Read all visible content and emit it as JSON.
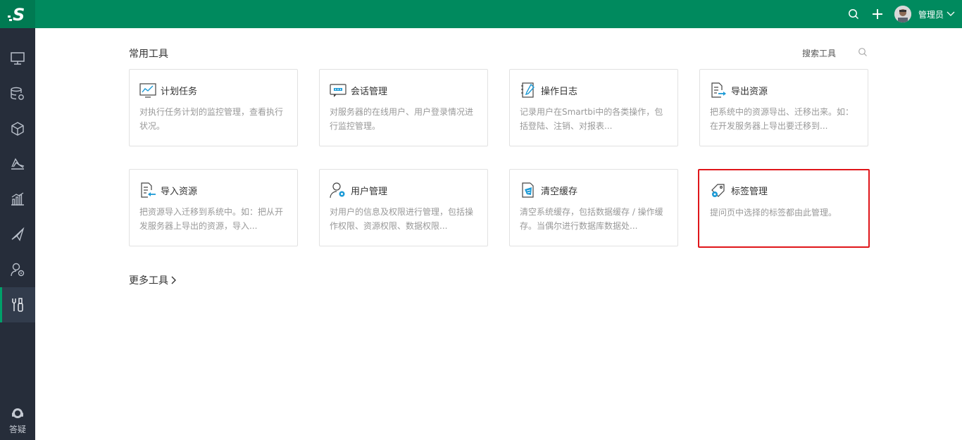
{
  "header": {
    "user_name": "管理员"
  },
  "sidebar": {
    "items": [
      {
        "icon": "monitor-icon"
      },
      {
        "icon": "database-gear-icon"
      },
      {
        "icon": "cube-icon"
      },
      {
        "icon": "layers-icon"
      },
      {
        "icon": "bar-chart-icon"
      },
      {
        "icon": "paper-plane-icon"
      },
      {
        "icon": "user-gear-icon"
      },
      {
        "icon": "tools-icon",
        "active": true
      }
    ],
    "help_label": "答疑"
  },
  "main": {
    "section_title": "常用工具",
    "search_label": "搜索工具",
    "tools": [
      {
        "title": "计划任务",
        "desc": "对执行任务计划的监控管理，查看执行状况。",
        "icon": "chart-screen-icon"
      },
      {
        "title": "会话管理",
        "desc": "对服务器的在线用户、用户登录情况进行监控管理。",
        "icon": "chat-screen-icon"
      },
      {
        "title": "操作日志",
        "desc": "记录用户在Smartbi中的各类操作，包括登陆、注销、对报表...",
        "icon": "notebook-pen-icon"
      },
      {
        "title": "导出资源",
        "desc": "把系统中的资源导出、迁移出来。如：在开发服务器上导出要迁移到...",
        "icon": "document-export-icon"
      },
      {
        "title": "导入资源",
        "desc": "把资源导入迁移到系统中。如：把从开发服务器上导出的资源，导入...",
        "icon": "document-import-icon"
      },
      {
        "title": "用户管理",
        "desc": "对用户的信息及权限进行管理，包括操作权限、资源权限、数据权限...",
        "icon": "user-gear-icon"
      },
      {
        "title": "清空缓存",
        "desc": "清空系统缓存，包括数据缓存 / 操作缓存。当偶尔进行数据库数据处...",
        "icon": "broom-icon"
      },
      {
        "title": "标签管理",
        "desc": "提问页中选择的标签都由此管理。",
        "icon": "tag-gear-icon",
        "selected": true
      }
    ],
    "more_tools_label": "更多工具"
  },
  "colors": {
    "topbar": "#008a5e",
    "sidebar": "#262d3a",
    "accent_blue": "#1c9ad6",
    "selected_border": "#e0161a"
  }
}
